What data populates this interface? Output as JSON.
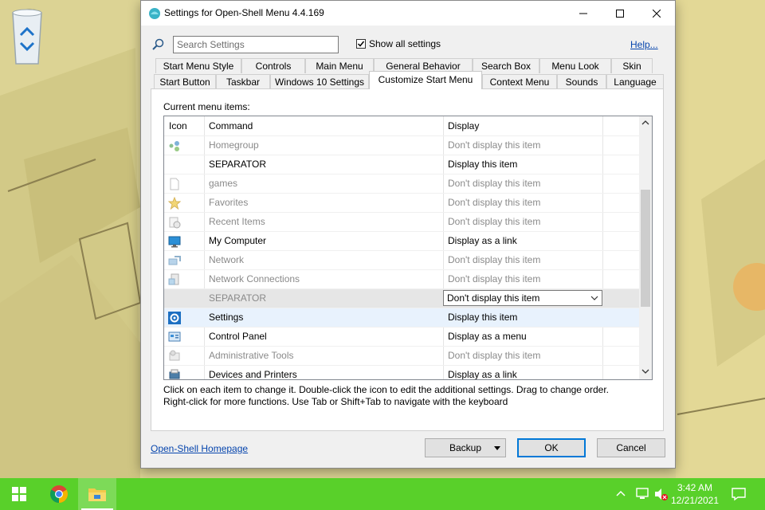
{
  "desktop": {
    "bin_label": "Bin"
  },
  "window": {
    "title": "Settings for Open-Shell Menu 4.4.169"
  },
  "search": {
    "placeholder": "Search Settings",
    "value": "",
    "show_all_label": "Show all settings",
    "show_all_checked": true,
    "help_link": "Help..."
  },
  "tabs": {
    "row1": [
      "Start Menu Style",
      "Controls",
      "Main Menu",
      "General Behavior",
      "Search Box",
      "Menu Look",
      "Skin"
    ],
    "row2": [
      "Start Button",
      "Taskbar",
      "Windows 10 Settings",
      "Customize Start Menu",
      "Context Menu",
      "Sounds",
      "Language"
    ],
    "active": "Customize Start Menu"
  },
  "menu_items": {
    "label": "Current menu items:",
    "columns": {
      "icon": "Icon",
      "command": "Command",
      "display": "Display"
    },
    "rows": [
      {
        "icon": "homegroup-icon",
        "command": "Homegroup",
        "display": "Don't display this item",
        "dim": true
      },
      {
        "icon": "",
        "command": "SEPARATOR",
        "display": "Display this item",
        "dim": false
      },
      {
        "icon": "blank-document-icon",
        "command": "games",
        "display": "Don't display this item",
        "dim": true
      },
      {
        "icon": "star-icon",
        "command": "Favorites",
        "display": "Don't display this item",
        "dim": true
      },
      {
        "icon": "recent-items-icon",
        "command": "Recent Items",
        "display": "Don't display this item",
        "dim": true
      },
      {
        "icon": "monitor-icon",
        "command": "My Computer",
        "display": "Display as a link",
        "dim": false
      },
      {
        "icon": "network-icon",
        "command": "Network",
        "display": "Don't display this item",
        "dim": true
      },
      {
        "icon": "network-connections-icon",
        "command": "Network Connections",
        "display": "Don't display this item",
        "dim": true
      },
      {
        "icon": "",
        "command": "SEPARATOR",
        "display": "Don't display this item",
        "dim": true,
        "selected": true
      },
      {
        "icon": "settings-gear-icon",
        "command": "Settings",
        "display": "Display this item",
        "dim": false
      },
      {
        "icon": "control-panel-icon",
        "command": "Control Panel",
        "display": "Display as a menu",
        "dim": false
      },
      {
        "icon": "administrative-tools-icon",
        "command": "Administrative Tools",
        "display": "Don't display this item",
        "dim": true
      },
      {
        "icon": "devices-printers-icon",
        "command": "Devices and Printers",
        "display": "Display as a link",
        "dim": false
      }
    ],
    "selected_dropdown_value": "Don't display this item"
  },
  "hint": {
    "line1": "Click on each item to change it. Double-click the icon to edit the additional settings. Drag to change order.",
    "line2": "Right-click for more functions. Use Tab or Shift+Tab to navigate with the keyboard"
  },
  "footer": {
    "homepage_link": "Open-Shell Homepage",
    "backup_label": "Backup",
    "ok_label": "OK",
    "cancel_label": "Cancel"
  },
  "taskbar": {
    "time": "3:42 AM",
    "date": "12/21/2021",
    "apps": [
      "windows-start-icon",
      "chrome-icon",
      "file-explorer-icon"
    ]
  },
  "colors": {
    "taskbar": "#59d02a",
    "link": "#0645ad",
    "accent": "#0078d7"
  }
}
